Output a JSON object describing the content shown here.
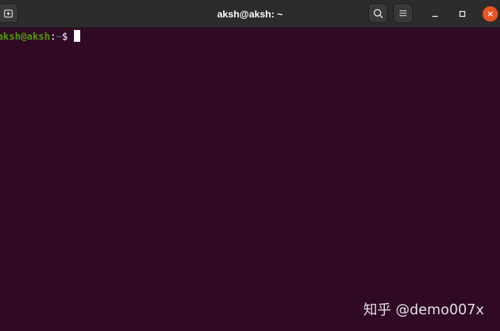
{
  "window": {
    "title": "aksh@aksh: ~"
  },
  "headerbar": {
    "new_tab_icon": "new-tab-icon",
    "search_icon": "search-icon",
    "menu_icon": "hamburger-menu-icon",
    "minimize_icon": "minimize-icon",
    "maximize_icon": "maximize-icon",
    "close_icon": "close-icon"
  },
  "terminal": {
    "prompt": {
      "user_host": "aksh@aksh",
      "separator": ":",
      "path": "~",
      "symbol": "$ "
    }
  },
  "watermark": {
    "text": "知乎 @demo007x"
  },
  "colors": {
    "terminal_background": "#300a24",
    "headerbar_background": "#2c2c2c",
    "prompt_user_color": "#4e9a06",
    "prompt_path_color": "#3465a4",
    "close_button_color": "#e95420"
  }
}
